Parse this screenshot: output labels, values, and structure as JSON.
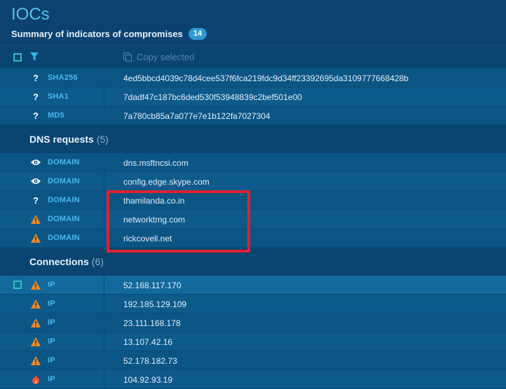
{
  "header": {
    "title": "IOCs",
    "subtitle": "Summary of indicators of compromises",
    "count": "14"
  },
  "toolbar": {
    "copy_label": "Copy selected"
  },
  "hashes": [
    {
      "icon": "question-icon",
      "type": "SHA256",
      "value": "4ed5bbcd4039c78d4cee537f6fca219fdc9d34ff23392695da3109777668428b"
    },
    {
      "icon": "question-icon",
      "type": "SHA1",
      "value": "7dadf47c187bc6ded530f53948839c2bef501e00"
    },
    {
      "icon": "question-icon",
      "type": "MD5",
      "value": "7a780cb85a7a077e7e1b122fa7027304"
    }
  ],
  "dns": {
    "label": "DNS requests",
    "count": "(5)",
    "items": [
      {
        "icon": "eye-icon",
        "type": "DOMAIN",
        "value": "dns.msftncsi.com"
      },
      {
        "icon": "eye-icon",
        "type": "DOMAIN",
        "value": "config.edge.skype.com"
      },
      {
        "icon": "question-icon",
        "type": "DOMAIN",
        "value": "thamilanda.co.in"
      },
      {
        "icon": "warning-icon",
        "type": "DOMAIN",
        "value": "networktmg.com"
      },
      {
        "icon": "warning-icon",
        "type": "DOMAIN",
        "value": "rickcovell.net"
      }
    ]
  },
  "connections": {
    "label": "Connections",
    "count": "(6)",
    "items": [
      {
        "icon": "warning-icon",
        "type": "IP",
        "value": "52.168.117.170"
      },
      {
        "icon": "warning-icon",
        "type": "IP",
        "value": "192.185.129.109"
      },
      {
        "icon": "warning-icon",
        "type": "IP",
        "value": "23.111.168.178"
      },
      {
        "icon": "warning-icon",
        "type": "IP",
        "value": "13.107.42.16"
      },
      {
        "icon": "warning-icon",
        "type": "IP",
        "value": "52.178.182.73"
      },
      {
        "icon": "fire-icon",
        "type": "IP",
        "value": "104.92.93.19"
      }
    ]
  },
  "colors": {
    "accent": "#56c1ec",
    "warning": "#f08a24",
    "danger": "#f04a3a",
    "highlight": "#e0202e"
  }
}
